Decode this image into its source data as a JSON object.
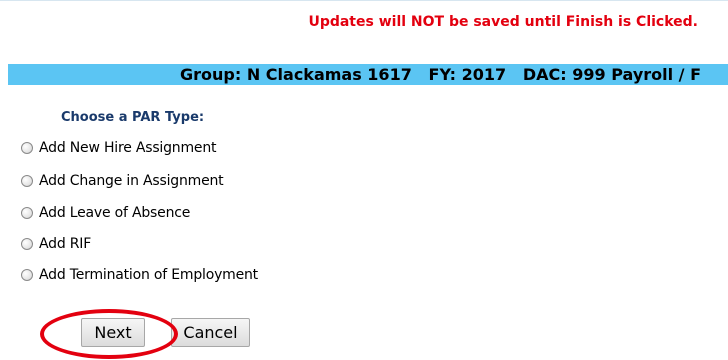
{
  "warning": "Updates will NOT be saved until Finish is Clicked.",
  "header": {
    "text": "Group: N Clackamas 1617   FY: 2017   DAC: 999 Payroll / F"
  },
  "par": {
    "heading": "Choose a PAR Type:",
    "options": [
      {
        "label": "Add New Hire Assignment",
        "selected": false
      },
      {
        "label": "Add Change in Assignment",
        "selected": false
      },
      {
        "label": "Add Leave of Absence",
        "selected": false
      },
      {
        "label": "Add RIF",
        "selected": false
      },
      {
        "label": "Add Termination of Employment",
        "selected": false
      }
    ]
  },
  "buttons": {
    "next": "Next",
    "cancel": "Cancel"
  },
  "colors": {
    "warning": "#e3000f",
    "header_bar": "#5bc5f3",
    "heading": "#1a3a6b",
    "highlight": "#e3000f"
  }
}
